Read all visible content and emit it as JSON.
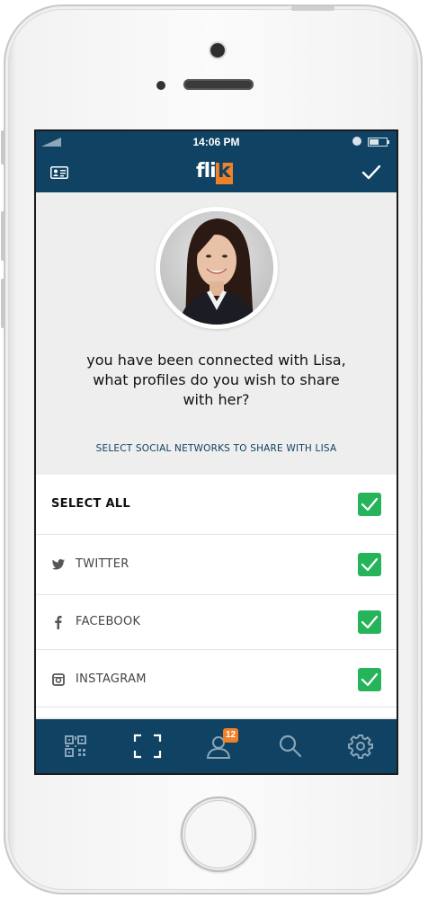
{
  "status_bar": {
    "time": "14:06 PM"
  },
  "nav_bar": {
    "logo_text": "fli",
    "logo_accent": "k",
    "left_icon": "contact-card-icon",
    "right_icon": "checkmark-icon"
  },
  "connection": {
    "message_line1": "you have been connected with Lisa,",
    "message_line2": "what profiles do you wish to share",
    "message_line3": "with her?",
    "subheading": "SELECT SOCIAL NETWORKS TO SHARE WITH LISA"
  },
  "networks": {
    "select_all": {
      "label": "SELECT ALL",
      "checked": true
    },
    "items": [
      {
        "label": "TWITTER",
        "icon": "twitter-icon",
        "checked": true
      },
      {
        "label": "FACEBOOK",
        "icon": "facebook-icon",
        "checked": true
      },
      {
        "label": "INSTAGRAM",
        "icon": "instagram-icon",
        "checked": true
      }
    ]
  },
  "tab_bar": {
    "tabs": [
      {
        "icon": "qr-code-icon"
      },
      {
        "icon": "scan-frame-icon"
      },
      {
        "icon": "contacts-icon",
        "badge": "12"
      },
      {
        "icon": "search-icon"
      },
      {
        "icon": "settings-gear-icon"
      }
    ]
  },
  "colors": {
    "primary": "#0f4263",
    "accent": "#f0812b",
    "check_green": "#26b45a",
    "background": "#eeeeee"
  }
}
